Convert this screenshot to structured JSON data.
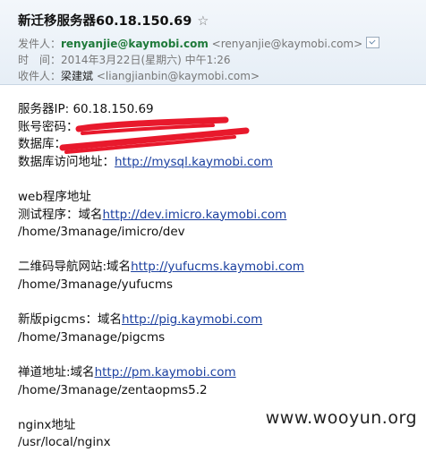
{
  "email": {
    "subject": "新迁移服务器60.18.150.69",
    "star_glyph": "☆",
    "sender_label": "发件人：",
    "sender_name": "renyanjie@kaymobi.com",
    "sender_addr": "<renyanjie@kaymobi.com>",
    "time_label": "时　间：",
    "time_value": "2014年3月22日(星期六) 中午1:26",
    "recipient_label": "收件人：",
    "recipient_name": "梁建斌",
    "recipient_addr": "<liangjianbin@kaymobi.com>"
  },
  "body": {
    "server_ip": "服务器IP: 60.18.150.69",
    "account_label": "账号密码：",
    "db_label": "数据库：",
    "db_access_label": "数据库访问地址：",
    "db_link": "http://mysql.kaymobi.com",
    "web_title": "web程序地址",
    "test_label": "测试程序：域名",
    "test_link": "http://dev.imicro.kaymobi.com",
    "test_path": "/home/3manage/imicro/dev",
    "qr_label": "二维码导航网站:域名",
    "qr_link": "http://yufucms.kaymobi.com",
    "qr_path": "/home/3manage/yufucms",
    "pig_label": "新版pigcms：域名",
    "pig_link": "http://pig.kaymobi.com",
    "pig_path": "/home/3manage/pigcms",
    "pm_label": "禅道地址:域名",
    "pm_link": "http://pm.kaymobi.com",
    "pm_path": "/home/3manage/zentaopms5.2",
    "nginx_label": "nginx地址",
    "nginx_path": "/usr/local/nginx"
  },
  "watermark": "www.wooyun.org",
  "colors": {
    "redaction": "#e8192c",
    "link": "#1a3f9f",
    "sender": "#1f7a3a"
  }
}
